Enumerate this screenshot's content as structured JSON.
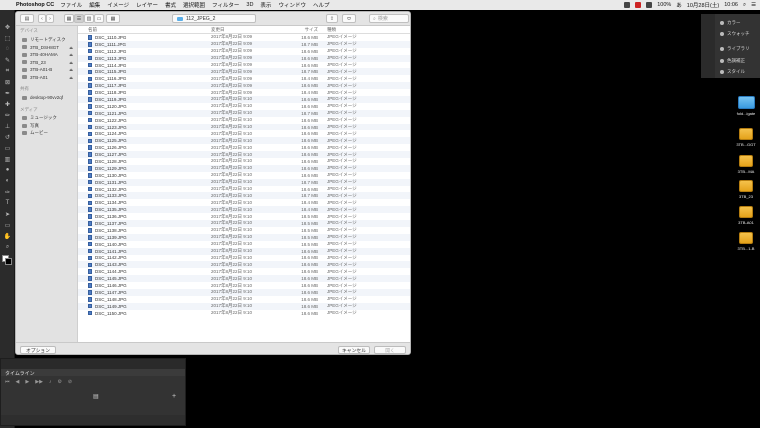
{
  "menubar": {
    "app": "Photoshop CC",
    "items": [
      "ファイル",
      "編集",
      "イメージ",
      "レイヤー",
      "書式",
      "選択範囲",
      "フィルター",
      "3D",
      "表示",
      "ウィンドウ",
      "ヘルプ"
    ],
    "battery": "100%",
    "input": "あ",
    "date": "10月28日(土)",
    "time": "10:06"
  },
  "dialog": {
    "folder": "112_JPEG_2",
    "search_placeholder": "検索",
    "columns": {
      "name": "名前",
      "date": "変更日",
      "size": "サイズ",
      "kind": "種類"
    },
    "sidebar": {
      "devices_header": "デバイス",
      "devices": [
        {
          "label": "リモートディスク",
          "eject": ""
        },
        {
          "label": "3TB_DSH8GT",
          "eject": "⏏"
        },
        {
          "label": "3TB-40HAMA",
          "eject": "⏏"
        },
        {
          "label": "3TB_23",
          "eject": "⏏"
        },
        {
          "label": "3TB-A01-B",
          "eject": "⏏"
        },
        {
          "label": "3TB-A01",
          "eject": "⏏"
        }
      ],
      "shared_header": "共有",
      "shared": [
        {
          "label": "desktop-90vv2qf"
        }
      ],
      "media_header": "メディア",
      "media": [
        {
          "label": "ミュージック"
        },
        {
          "label": "写真"
        },
        {
          "label": "ムービー"
        }
      ]
    },
    "files": [
      {
        "name": "DSC_1110.JPG",
        "date": "2017年8月22日 9:09",
        "size": "18.6 MB",
        "kind": "JPEGイメージ"
      },
      {
        "name": "DSC_1111.JPG",
        "date": "2017年8月22日 9:09",
        "size": "18.7 MB",
        "kind": "JPEGイメージ"
      },
      {
        "name": "DSC_1112.JPG",
        "date": "2017年8月22日 9:09",
        "size": "18.6 MB",
        "kind": "JPEGイメージ"
      },
      {
        "name": "DSC_1113.JPG",
        "date": "2017年8月22日 9:09",
        "size": "18.6 MB",
        "kind": "JPEGイメージ"
      },
      {
        "name": "DSC_1114.JPG",
        "date": "2017年8月22日 9:09",
        "size": "18.6 MB",
        "kind": "JPEGイメージ"
      },
      {
        "name": "DSC_1115.JPG",
        "date": "2017年8月22日 9:09",
        "size": "18.7 MB",
        "kind": "JPEGイメージ"
      },
      {
        "name": "DSC_1116.JPG",
        "date": "2017年8月22日 9:09",
        "size": "18.4 MB",
        "kind": "JPEGイメージ"
      },
      {
        "name": "DSC_1117.JPG",
        "date": "2017年8月22日 9:09",
        "size": "18.6 MB",
        "kind": "JPEGイメージ"
      },
      {
        "name": "DSC_1118.JPG",
        "date": "2017年8月22日 9:09",
        "size": "18.4 MB",
        "kind": "JPEGイメージ"
      },
      {
        "name": "DSC_1119.JPG",
        "date": "2017年8月22日 9:10",
        "size": "18.6 MB",
        "kind": "JPEGイメージ"
      },
      {
        "name": "DSC_1120.JPG",
        "date": "2017年8月22日 9:10",
        "size": "18.6 MB",
        "kind": "JPEGイメージ"
      },
      {
        "name": "DSC_1121.JPG",
        "date": "2017年8月22日 9:10",
        "size": "18.7 MB",
        "kind": "JPEGイメージ"
      },
      {
        "name": "DSC_1122.JPG",
        "date": "2017年8月22日 9:10",
        "size": "18.6 MB",
        "kind": "JPEGイメージ"
      },
      {
        "name": "DSC_1123.JPG",
        "date": "2017年8月22日 9:10",
        "size": "18.6 MB",
        "kind": "JPEGイメージ"
      },
      {
        "name": "DSC_1124.JPG",
        "date": "2017年8月22日 9:10",
        "size": "18.6 MB",
        "kind": "JPEGイメージ"
      },
      {
        "name": "DSC_1125.JPG",
        "date": "2017年8月22日 9:10",
        "size": "18.6 MB",
        "kind": "JPEGイメージ"
      },
      {
        "name": "DSC_1126.JPG",
        "date": "2017年8月22日 9:10",
        "size": "18.6 MB",
        "kind": "JPEGイメージ"
      },
      {
        "name": "DSC_1127.JPG",
        "date": "2017年8月22日 9:10",
        "size": "18.6 MB",
        "kind": "JPEGイメージ"
      },
      {
        "name": "DSC_1128.JPG",
        "date": "2017年8月22日 9:10",
        "size": "18.6 MB",
        "kind": "JPEGイメージ"
      },
      {
        "name": "DSC_1129.JPG",
        "date": "2017年8月22日 9:10",
        "size": "18.6 MB",
        "kind": "JPEGイメージ"
      },
      {
        "name": "DSC_1130.JPG",
        "date": "2017年8月22日 9:10",
        "size": "18.6 MB",
        "kind": "JPEGイメージ"
      },
      {
        "name": "DSC_1131.JPG",
        "date": "2017年8月22日 9:10",
        "size": "18.7 MB",
        "kind": "JPEGイメージ"
      },
      {
        "name": "DSC_1132.JPG",
        "date": "2017年8月22日 9:10",
        "size": "18.6 MB",
        "kind": "JPEGイメージ"
      },
      {
        "name": "DSC_1133.JPG",
        "date": "2017年8月22日 9:10",
        "size": "18.7 MB",
        "kind": "JPEGイメージ"
      },
      {
        "name": "DSC_1134.JPG",
        "date": "2017年8月22日 9:10",
        "size": "18.4 MB",
        "kind": "JPEGイメージ"
      },
      {
        "name": "DSC_1135.JPG",
        "date": "2017年8月22日 9:10",
        "size": "18.4 MB",
        "kind": "JPEGイメージ"
      },
      {
        "name": "DSC_1136.JPG",
        "date": "2017年8月22日 9:10",
        "size": "18.5 MB",
        "kind": "JPEGイメージ"
      },
      {
        "name": "DSC_1137.JPG",
        "date": "2017年8月22日 9:10",
        "size": "18.5 MB",
        "kind": "JPEGイメージ"
      },
      {
        "name": "DSC_1138.JPG",
        "date": "2017年8月22日 9:10",
        "size": "18.5 MB",
        "kind": "JPEGイメージ"
      },
      {
        "name": "DSC_1139.JPG",
        "date": "2017年8月22日 9:10",
        "size": "18.5 MB",
        "kind": "JPEGイメージ"
      },
      {
        "name": "DSC_1140.JPG",
        "date": "2017年8月22日 9:10",
        "size": "18.5 MB",
        "kind": "JPEGイメージ"
      },
      {
        "name": "DSC_1141.JPG",
        "date": "2017年8月22日 9:10",
        "size": "18.6 MB",
        "kind": "JPEGイメージ"
      },
      {
        "name": "DSC_1142.JPG",
        "date": "2017年8月22日 9:10",
        "size": "18.6 MB",
        "kind": "JPEGイメージ"
      },
      {
        "name": "DSC_1143.JPG",
        "date": "2017年8月22日 9:10",
        "size": "18.6 MB",
        "kind": "JPEGイメージ"
      },
      {
        "name": "DSC_1144.JPG",
        "date": "2017年8月22日 9:10",
        "size": "18.6 MB",
        "kind": "JPEGイメージ"
      },
      {
        "name": "DSC_1145.JPG",
        "date": "2017年8月22日 9:10",
        "size": "18.6 MB",
        "kind": "JPEGイメージ"
      },
      {
        "name": "DSC_1146.JPG",
        "date": "2017年8月22日 9:10",
        "size": "18.6 MB",
        "kind": "JPEGイメージ"
      },
      {
        "name": "DSC_1147.JPG",
        "date": "2017年8月22日 9:10",
        "size": "18.6 MB",
        "kind": "JPEGイメージ"
      },
      {
        "name": "DSC_1148.JPG",
        "date": "2017年8月22日 9:10",
        "size": "18.6 MB",
        "kind": "JPEGイメージ"
      },
      {
        "name": "DSC_1149.JPG",
        "date": "2017年8月22日 9:10",
        "size": "18.6 MB",
        "kind": "JPEGイメージ"
      },
      {
        "name": "DSC_1150.JPG",
        "date": "2017年8月22日 9:10",
        "size": "18.6 MB",
        "kind": "JPEGイメージ"
      }
    ],
    "options_button": "オプション",
    "cancel_button": "キャンセル",
    "open_button": "開く"
  },
  "right_panel": {
    "items": [
      "カラー",
      "スウォッチ",
      "ライブラリ",
      "色調補正",
      "スタイル"
    ]
  },
  "desktop_icons": [
    "fold...igate",
    "3TB...GGT",
    "3TB...MA",
    "3TB_23",
    "3TB-A01",
    "3TB...1-B"
  ],
  "timeline": {
    "title": "タイムライン"
  }
}
